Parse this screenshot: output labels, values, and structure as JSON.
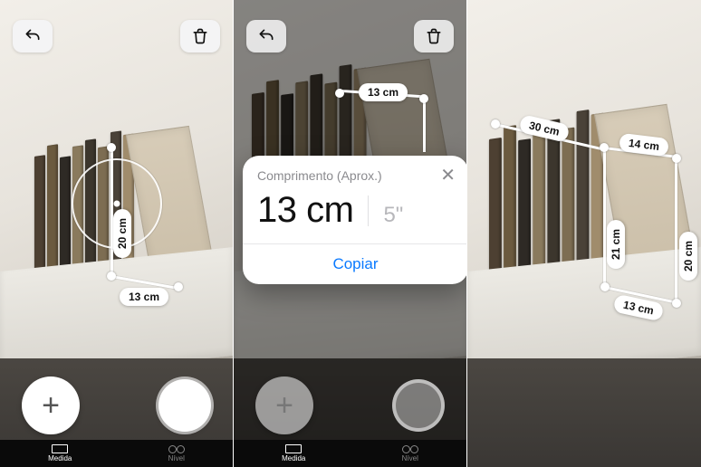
{
  "panel1": {
    "undo_label": "undo",
    "trash_label": "delete",
    "add_label": "+",
    "reticle": true,
    "measurements": {
      "height": "20 cm",
      "width": "13 cm"
    },
    "tabs": {
      "measure": "Medida",
      "level": "Nível"
    }
  },
  "panel2": {
    "undo_label": "undo",
    "trash_label": "delete",
    "add_label": "+",
    "measurements": {
      "top": "13 cm"
    },
    "popup": {
      "title": "Comprimento (Aprox.)",
      "primary": "13 cm",
      "secondary": "5\"",
      "action": "Copiar",
      "close": "✕"
    },
    "tabs": {
      "measure": "Medida",
      "level": "Nível"
    }
  },
  "panel3": {
    "measurements": {
      "depth": "30 cm",
      "top_width": "14 cm",
      "left_height": "21 cm",
      "right_height": "20 cm",
      "bottom_width": "13 cm"
    }
  }
}
